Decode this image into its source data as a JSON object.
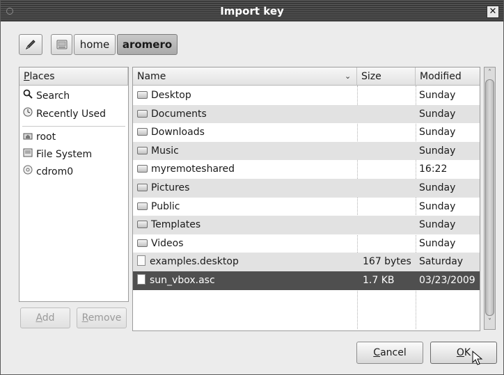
{
  "window": {
    "title": "Import key"
  },
  "pathbar": {
    "edit_icon": "pencil-icon",
    "drive_icon": "drive-icon",
    "crumbs": [
      "home",
      "aromero"
    ]
  },
  "places": {
    "header_prefix": "P",
    "header_rest": "laces",
    "items": [
      {
        "label": "Search",
        "icon": "magnifier-icon"
      },
      {
        "label": "Recently Used",
        "icon": "clock-icon"
      },
      {
        "label": "root",
        "icon": "home-folder-icon"
      },
      {
        "label": "File System",
        "icon": "drive-icon"
      },
      {
        "label": "cdrom0",
        "icon": "cd-icon"
      }
    ],
    "add_prefix": "",
    "add_u": "A",
    "add_rest": "dd",
    "remove_u": "R",
    "remove_rest": "emove"
  },
  "files": {
    "headers": {
      "name": "Name",
      "size": "Size",
      "modified": "Modified"
    },
    "rows": [
      {
        "name": "Desktop",
        "size": "",
        "modified": "Sunday",
        "type": "folder"
      },
      {
        "name": "Documents",
        "size": "",
        "modified": "Sunday",
        "type": "folder"
      },
      {
        "name": "Downloads",
        "size": "",
        "modified": "Sunday",
        "type": "folder"
      },
      {
        "name": "Music",
        "size": "",
        "modified": "Sunday",
        "type": "folder"
      },
      {
        "name": "myremoteshared",
        "size": "",
        "modified": "16:22",
        "type": "folder"
      },
      {
        "name": "Pictures",
        "size": "",
        "modified": "Sunday",
        "type": "folder"
      },
      {
        "name": "Public",
        "size": "",
        "modified": "Sunday",
        "type": "folder"
      },
      {
        "name": "Templates",
        "size": "",
        "modified": "Sunday",
        "type": "folder"
      },
      {
        "name": "Videos",
        "size": "",
        "modified": "Sunday",
        "type": "folder"
      },
      {
        "name": "examples.desktop",
        "size": "167 bytes",
        "modified": "Saturday",
        "type": "file"
      },
      {
        "name": "sun_vbox.asc",
        "size": "1.7 KB",
        "modified": "03/23/2009",
        "type": "file",
        "selected": true
      }
    ]
  },
  "dialog": {
    "cancel_u": "C",
    "cancel_rest": "ancel",
    "ok_u": "O",
    "ok_rest": "K"
  }
}
